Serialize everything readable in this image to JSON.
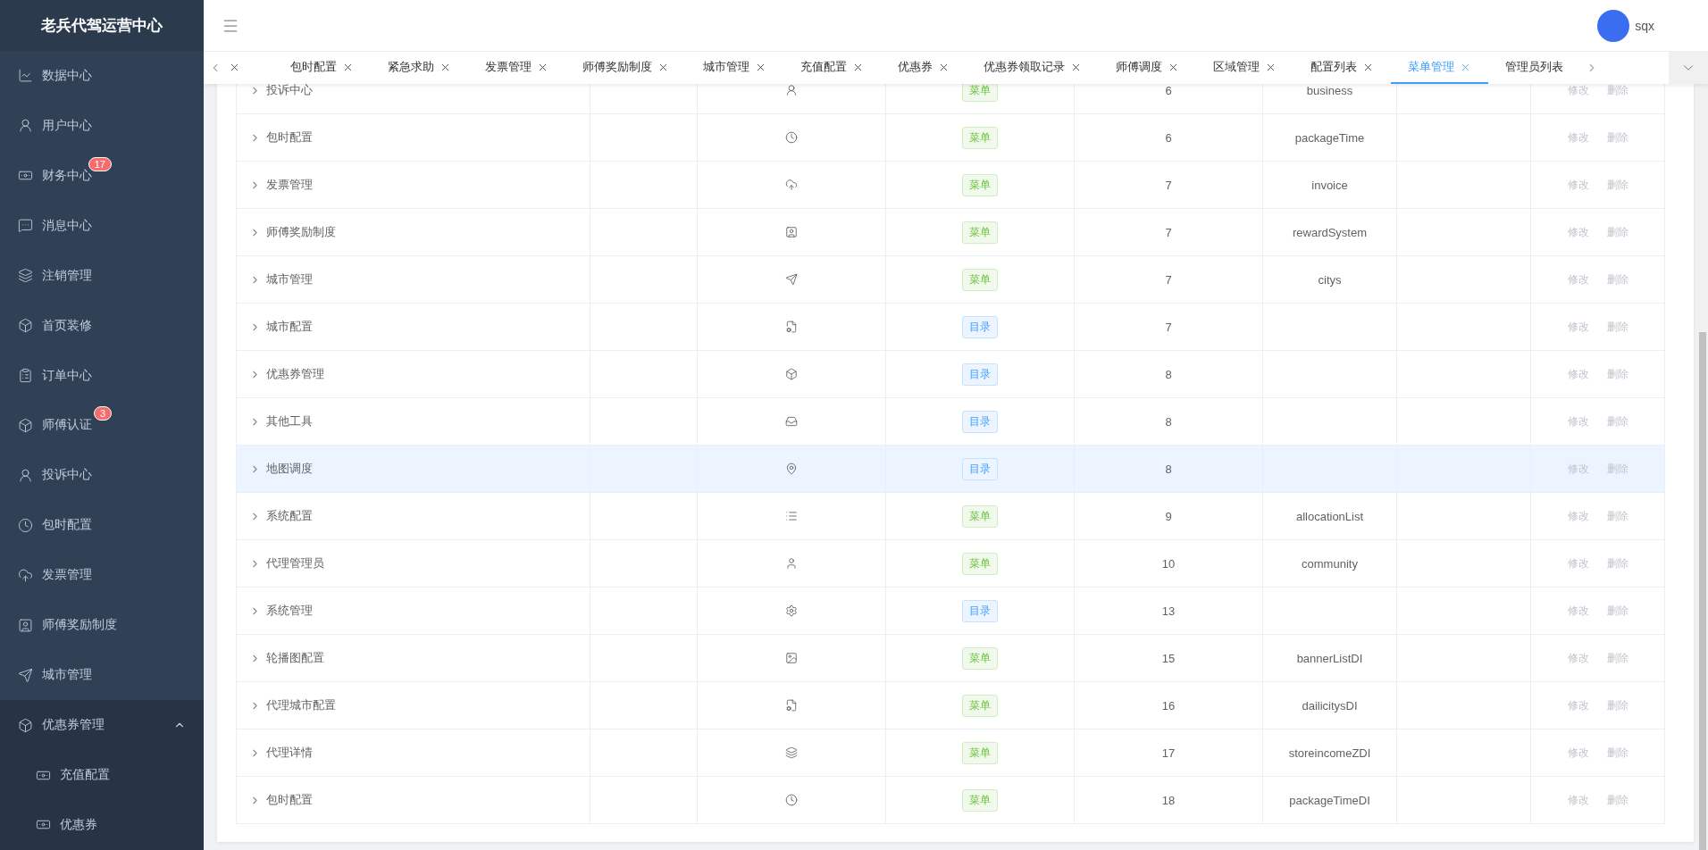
{
  "sidebar": {
    "title": "老兵代驾运营中心",
    "items": [
      {
        "label": "数据中心",
        "selected": false
      },
      {
        "label": "用户中心",
        "selected": false
      },
      {
        "label": "财务中心",
        "badge": "17",
        "selected": false
      },
      {
        "label": "消息中心",
        "selected": false
      },
      {
        "label": "注销管理",
        "selected": false
      },
      {
        "label": "首页装修",
        "selected": false
      },
      {
        "label": "订单中心",
        "selected": false
      },
      {
        "label": "师傅认证",
        "badge": "3",
        "selected": false
      },
      {
        "label": "投诉中心",
        "selected": false
      },
      {
        "label": "包时配置",
        "selected": false
      },
      {
        "label": "发票管理",
        "selected": false
      },
      {
        "label": "师傅奖励制度",
        "selected": false
      },
      {
        "label": "城市管理",
        "selected": false
      },
      {
        "label": "优惠券管理",
        "expanded": true,
        "selected": false,
        "children": [
          {
            "label": "充值配置",
            "selected": false
          },
          {
            "label": "优惠券",
            "selected": false
          }
        ]
      }
    ]
  },
  "header": {
    "user": "sqx"
  },
  "tabs": [
    {
      "selected": false,
      "closable": true
    },
    {
      "label": "包时配置",
      "selected": false,
      "closable": true
    },
    {
      "label": "紧急求助",
      "selected": false,
      "closable": true
    },
    {
      "label": "发票管理",
      "selected": false,
      "closable": true
    },
    {
      "label": "师傅奖励制度",
      "selected": false,
      "closable": true
    },
    {
      "label": "城市管理",
      "selected": false,
      "closable": true
    },
    {
      "label": "充值配置",
      "selected": false,
      "closable": true
    },
    {
      "label": "优惠券",
      "selected": false,
      "closable": true
    },
    {
      "label": "优惠券领取记录",
      "selected": false,
      "closable": true
    },
    {
      "label": "师傅调度",
      "selected": false,
      "closable": true
    },
    {
      "label": "区域管理",
      "selected": false,
      "closable": true
    },
    {
      "label": "配置列表",
      "selected": false,
      "closable": true
    },
    {
      "label": "菜单管理",
      "selected": true,
      "closable": true
    },
    {
      "label": "管理员列表",
      "selected": false,
      "closable": false
    }
  ],
  "table": {
    "rows": [
      {
        "name": "投诉中心",
        "type": "菜单",
        "order": "6",
        "path": "business",
        "actions": [
          "修改",
          "删除"
        ],
        "selected": false
      },
      {
        "name": "包时配置",
        "type": "菜单",
        "order": "6",
        "path": "packageTime",
        "actions": [
          "修改",
          "删除"
        ],
        "selected": false
      },
      {
        "name": "发票管理",
        "type": "菜单",
        "order": "7",
        "path": "invoice",
        "actions": [
          "修改",
          "删除"
        ],
        "selected": false
      },
      {
        "name": "师傅奖励制度",
        "type": "菜单",
        "order": "7",
        "path": "rewardSystem",
        "actions": [
          "修改",
          "删除"
        ],
        "selected": false
      },
      {
        "name": "城市管理",
        "type": "菜单",
        "order": "7",
        "path": "citys",
        "actions": [
          "修改",
          "删除"
        ],
        "selected": false
      },
      {
        "name": "城市配置",
        "type": "目录",
        "order": "7",
        "actions": [
          "修改",
          "删除"
        ],
        "selected": false
      },
      {
        "name": "优惠券管理",
        "type": "目录",
        "order": "8",
        "actions": [
          "修改",
          "删除"
        ],
        "selected": false
      },
      {
        "name": "其他工具",
        "type": "目录",
        "order": "8",
        "actions": [
          "修改",
          "删除"
        ],
        "selected": false
      },
      {
        "name": "地图调度",
        "type": "目录",
        "order": "8",
        "actions": [
          "修改",
          "删除"
        ],
        "selected": true
      },
      {
        "name": "系统配置",
        "type": "菜单",
        "order": "9",
        "path": "allocationList",
        "actions": [
          "修改",
          "删除"
        ],
        "selected": false
      },
      {
        "name": "代理管理员",
        "type": "菜单",
        "order": "10",
        "path": "community",
        "actions": [
          "修改",
          "删除"
        ],
        "selected": false
      },
      {
        "name": "系统管理",
        "type": "目录",
        "order": "13",
        "actions": [
          "修改",
          "删除"
        ],
        "selected": false
      },
      {
        "name": "轮播图配置",
        "type": "菜单",
        "order": "15",
        "path": "bannerListDI",
        "actions": [
          "修改",
          "删除"
        ],
        "selected": false
      },
      {
        "name": "代理城市配置",
        "type": "菜单",
        "order": "16",
        "path": "dailicitysDI",
        "actions": [
          "修改",
          "删除"
        ],
        "selected": false
      },
      {
        "name": "代理详情",
        "type": "菜单",
        "order": "17",
        "path": "storeincomeZDI",
        "actions": [
          "修改",
          "删除"
        ],
        "selected": false
      },
      {
        "name": "包时配置",
        "type": "菜单",
        "order": "18",
        "path": "packageTimeDI",
        "actions": [
          "修改",
          "删除"
        ],
        "selected": false
      }
    ]
  }
}
